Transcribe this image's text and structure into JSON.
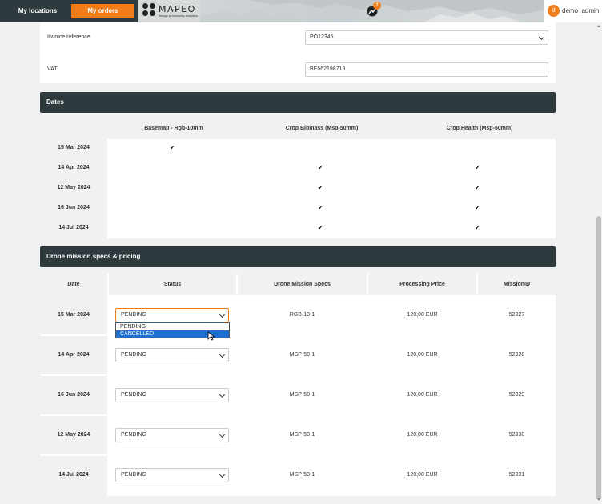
{
  "nav": {
    "locations_label": "My locations",
    "orders_label": "My orders",
    "logo_name": "MAPEO",
    "logo_tagline": "image processing analytics",
    "notification_count": "7",
    "user_initial": "d",
    "username": "demo_admin"
  },
  "invoice": {
    "label": "Invoice reference",
    "selected": "PO12345"
  },
  "vat": {
    "label": "VAT",
    "value": "BE562198718"
  },
  "dates": {
    "title": "Dates",
    "columns": [
      "Basemap - Rgb-10mm",
      "Crop Biomass (Msp-50mm)",
      "Crop Health (Msp-50mm)"
    ],
    "rows": [
      {
        "date": "15 Mar 2024",
        "checks": [
          true,
          false,
          false
        ]
      },
      {
        "date": "14 Apr 2024",
        "checks": [
          false,
          true,
          true
        ]
      },
      {
        "date": "12 May 2024",
        "checks": [
          false,
          true,
          true
        ]
      },
      {
        "date": "16 Jun 2024",
        "checks": [
          false,
          true,
          true
        ]
      },
      {
        "date": "14 Jul 2024",
        "checks": [
          false,
          true,
          true
        ]
      }
    ],
    "check_glyph": "✔"
  },
  "missions": {
    "title": "Drone mission specs & pricing",
    "columns": [
      "Date",
      "Status",
      "Drone Mission Specs",
      "Processing Price",
      "MissionID"
    ],
    "rows": [
      {
        "date": "15 Mar 2024",
        "status": "PENDING",
        "specs": "RGB-10-1",
        "price": "120,00 EUR",
        "mission_id": "52327"
      },
      {
        "date": "14 Apr 2024",
        "status": "PENDING",
        "specs": "MSP-50-1",
        "price": "120,00 EUR",
        "mission_id": "52328"
      },
      {
        "date": "16 Jun 2024",
        "status": "PENDING",
        "specs": "MSP-50-1",
        "price": "120,00 EUR",
        "mission_id": "52329"
      },
      {
        "date": "12 May 2024",
        "status": "PENDING",
        "specs": "MSP-50-1",
        "price": "120,00 EUR",
        "mission_id": "52330"
      },
      {
        "date": "14 Jul 2024",
        "status": "PENDING",
        "specs": "MSP-50-1",
        "price": "120,00 EUR",
        "mission_id": "52331"
      }
    ],
    "dropdown_options": [
      "PENDING",
      "CANCELLED"
    ],
    "dropdown_highlighted": "CANCELLED"
  },
  "colors": {
    "accent": "#f07c1a",
    "dark": "#2f3a3e",
    "highlight": "#1e6fd0"
  }
}
